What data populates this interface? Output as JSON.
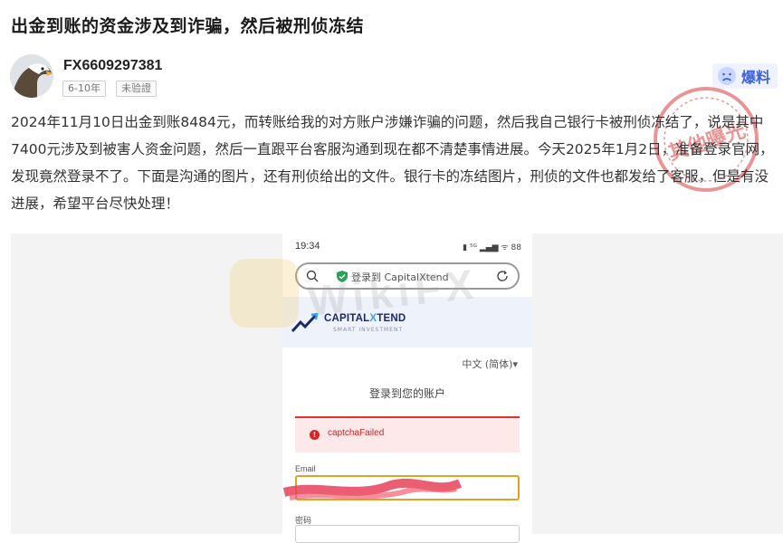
{
  "post": {
    "title": "出金到账的资金涉及到诈骗，然后被刑侦冻结",
    "body": "2024年11月10日出金到账8484元，而转账给我的对方账户涉嫌诈骗的问题，然后我自己银行卡被刑侦冻结了，说是其中7400元涉及到被害人资金问题，然后一直跟平台客服沟通到现在都不清楚事情进展。今天2025年1月2日，准备登录官网，发现竟然登录不了。下面是沟通的图片，还有刑侦给出的文件。银行卡的冻结图片，刑侦的文件也都发给了客服，但是有没进展，希望平台尽快处理！"
  },
  "user": {
    "name": "FX6609297381",
    "tags": [
      "6-10年",
      "未验證"
    ]
  },
  "actions": {
    "expose_label": "爆料"
  },
  "stamp": {
    "text": "其他曝光"
  },
  "screenshot": {
    "status_time": "19:34",
    "status_icons": "▮ ⁵ᴳ ▂▄▆ ᯤ 88",
    "url_text": "登录到 CapitalXtend",
    "brand_name_main": "CAPITAL",
    "brand_name_x": "X",
    "brand_name_end": "TEND",
    "brand_tagline": "SMART INVESTMENT",
    "language": "中文 (简体)▾",
    "login_title": "登录到您的账户",
    "error_text": "captchaFailed",
    "email_label": "Email",
    "password_label": "密码",
    "watermark_text": "WikiFX"
  },
  "colors": {
    "accent": "#3e63d8",
    "error": "#d33333",
    "input_focus": "#e0a224"
  }
}
